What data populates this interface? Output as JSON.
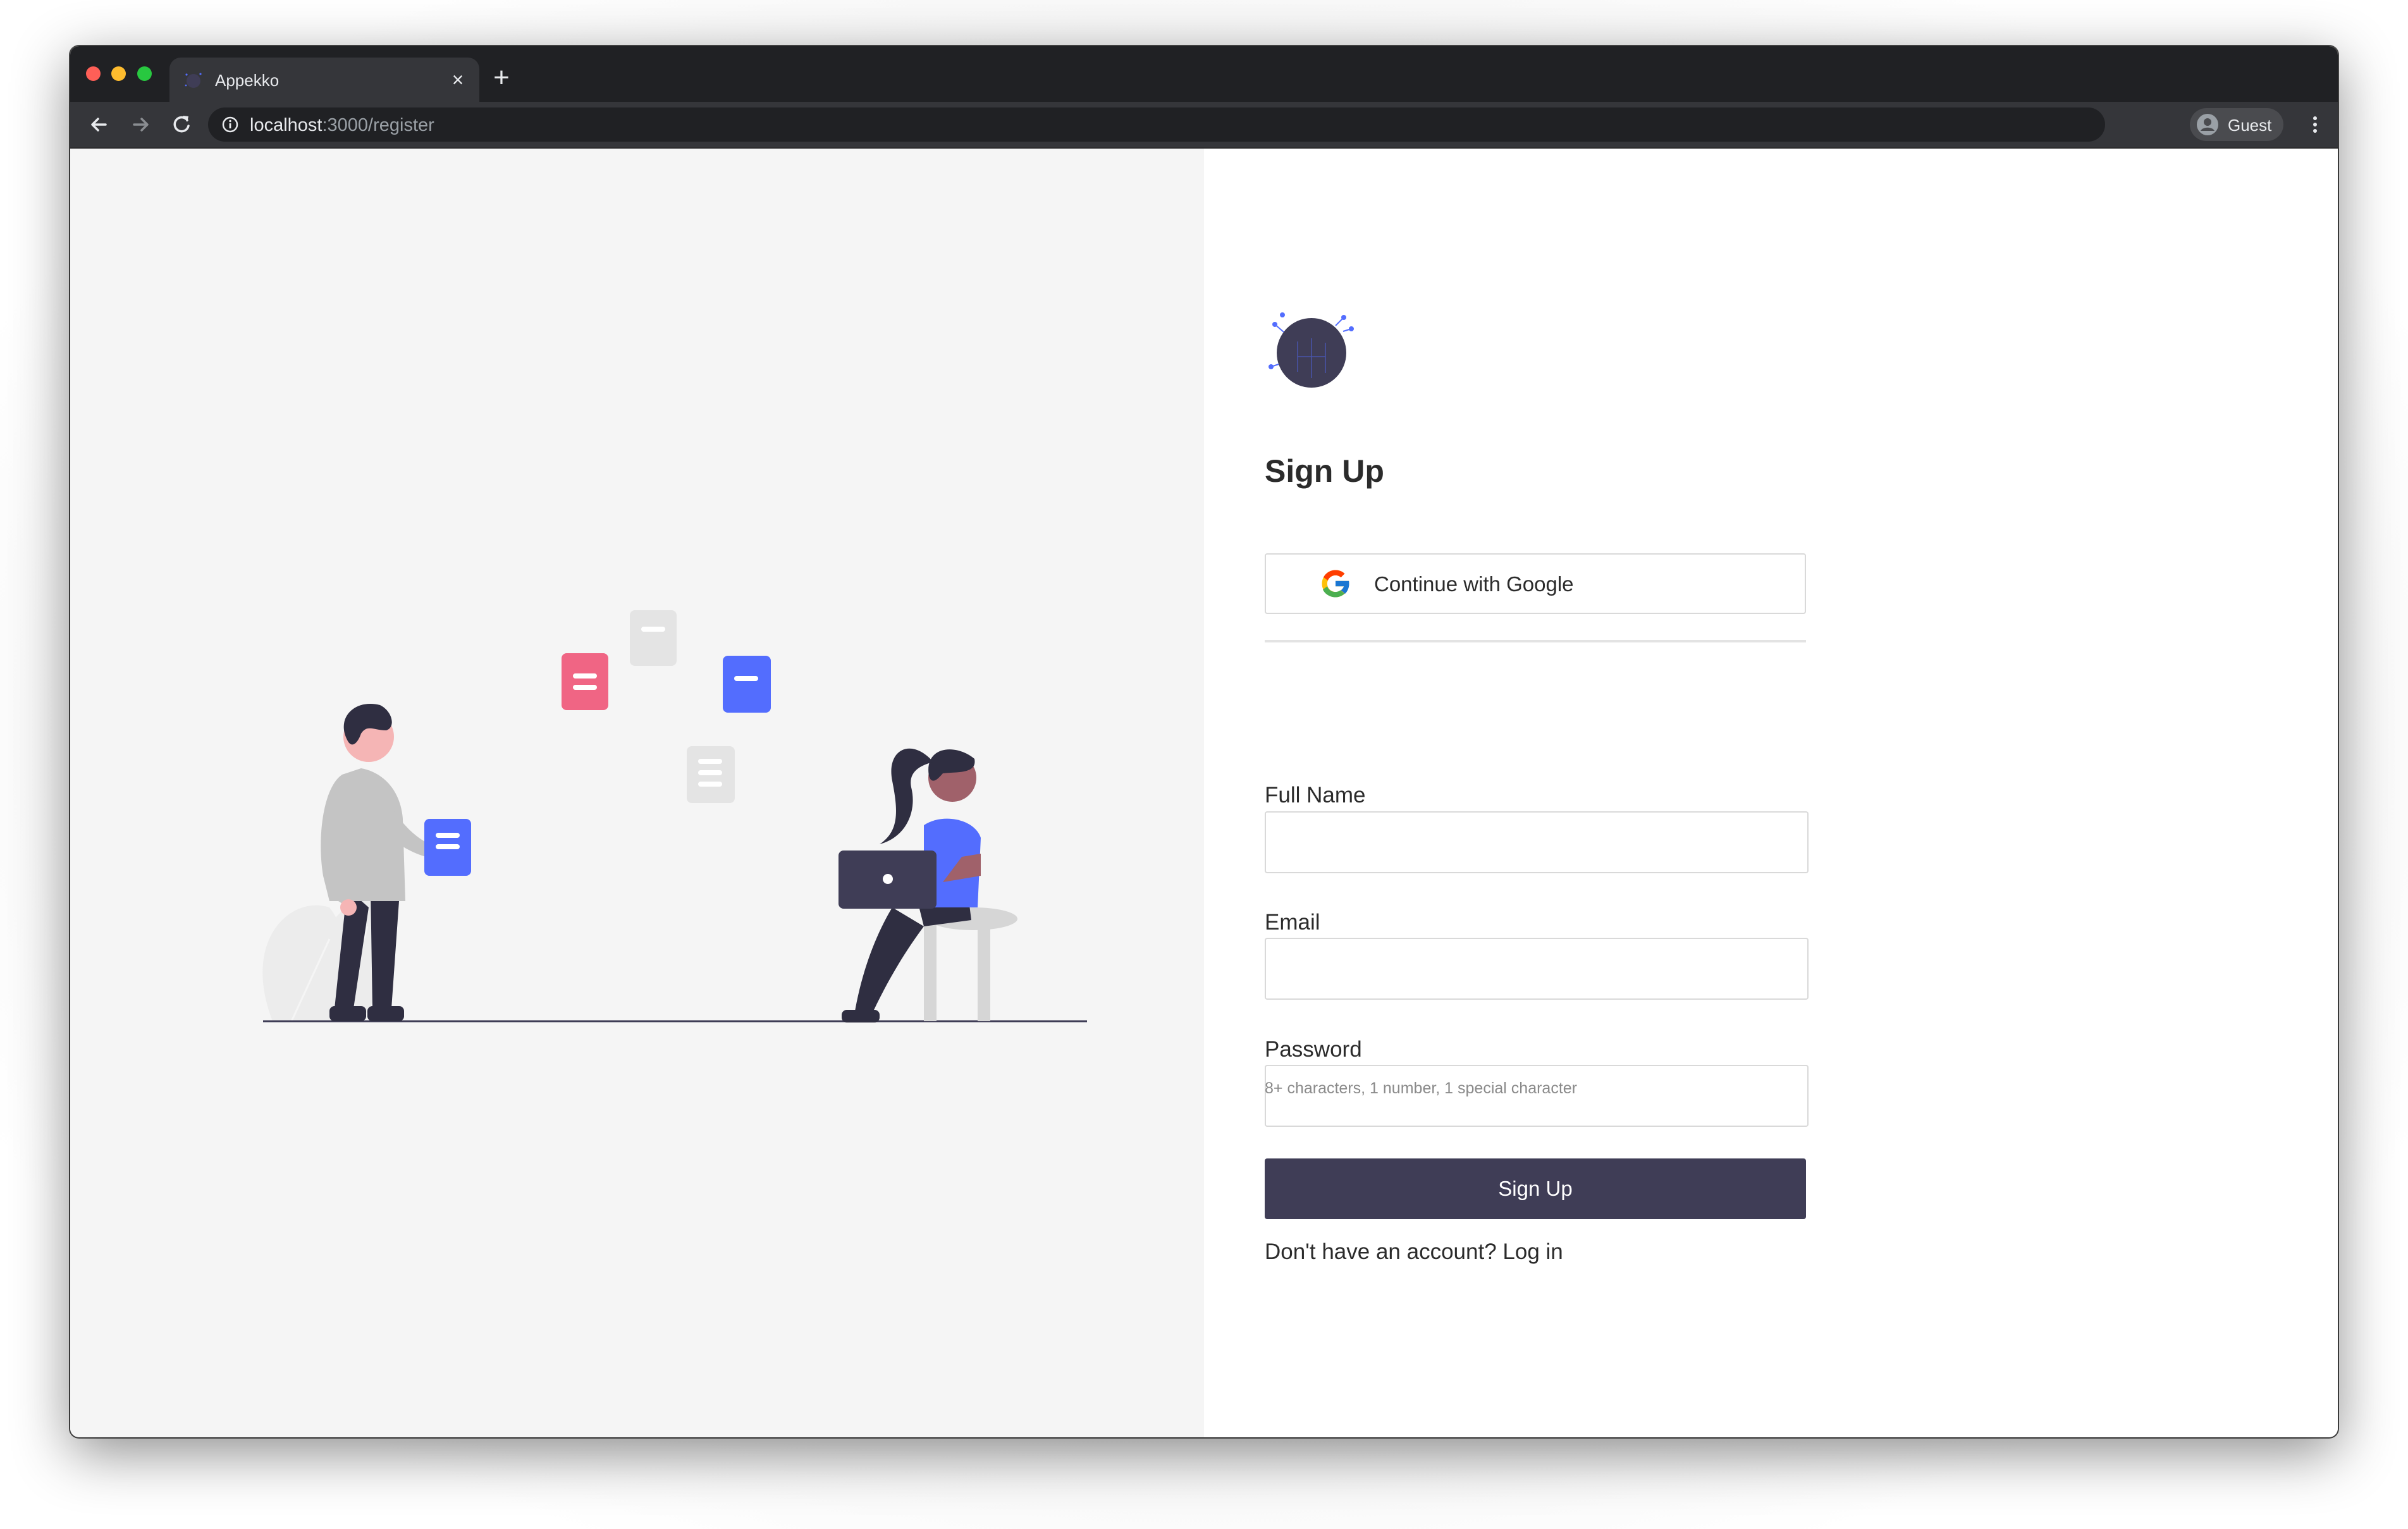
{
  "browser": {
    "tab_title": "Appekko",
    "tab_close": "×",
    "new_tab": "+",
    "url_host": "localhost",
    "url_path": ":3000/register",
    "profile_label": "Guest"
  },
  "form": {
    "title": "Sign Up",
    "google_button": "Continue with Google",
    "fields": [
      {
        "label": "Full Name",
        "value": "",
        "placeholder": ""
      },
      {
        "label": "Email",
        "value": "",
        "placeholder": ""
      },
      {
        "label": "Password",
        "value": "",
        "placeholder": ""
      }
    ],
    "password_hint": "8+ characters, 1 number, 1 special character",
    "submit_label": "Sign Up",
    "footer_text": "Don't have an account?",
    "footer_link": "Log in"
  },
  "icons": {
    "back": "arrow-left-icon",
    "forward": "arrow-right-icon",
    "reload": "reload-icon",
    "info": "info-icon",
    "profile": "account-circle-icon",
    "menu": "more-vertical-icon",
    "google": "google-g-icon",
    "logo": "appekko-logo"
  },
  "colors": {
    "primary": "#3f3d56",
    "accent_blue": "#536dfe",
    "accent_pink": "#f06584",
    "left_panel_bg": "#f5f5f5",
    "chrome_dark": "#202124"
  }
}
